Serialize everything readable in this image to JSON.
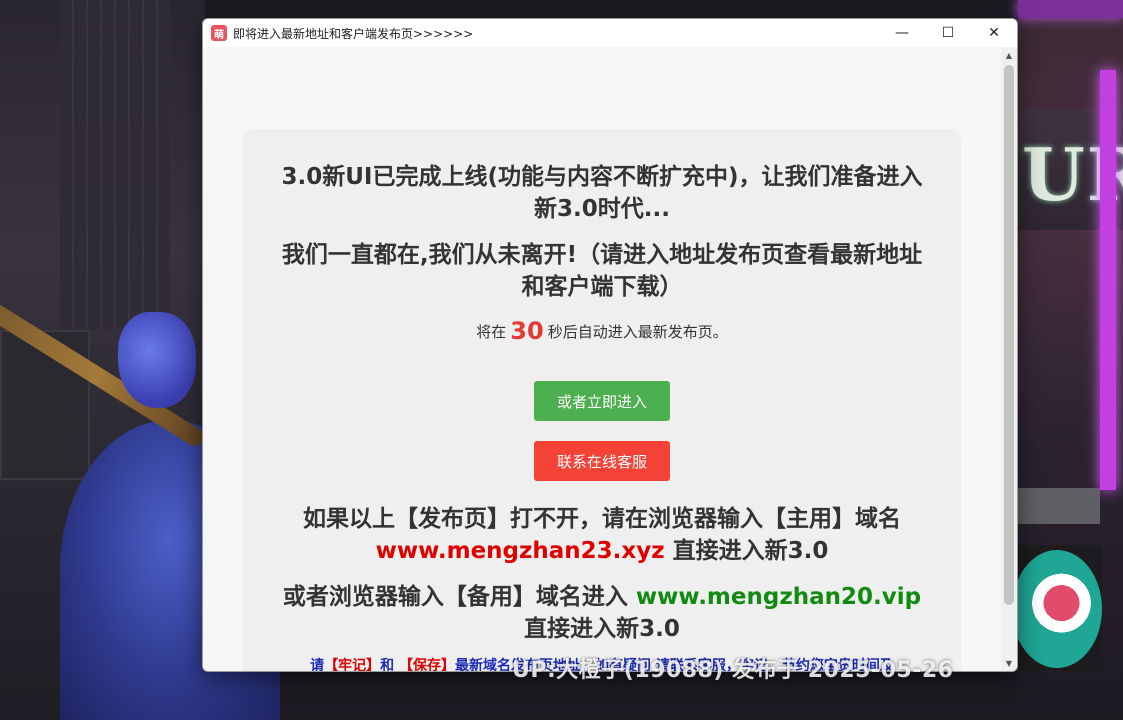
{
  "window": {
    "title": "即将进入最新地址和客户端发布页>>>>>>",
    "app_icon_glyph": "萌",
    "minimize_glyph": "—",
    "maximize_glyph": "☐",
    "close_glyph": "✕"
  },
  "content": {
    "headline1": "3.0新UI已完成上线(功能与内容不断扩充中)，让我们准备进入新3.0时代...",
    "headline2": "我们一直都在,我们从未离开!（请进入地址发布页查看最新地址和客户端下载）",
    "countdown": {
      "prefix": "将在",
      "seconds": "30",
      "suffix": "秒后自动进入最新发布页。"
    },
    "enter_button": "或者立即进入",
    "support_button": "联系在线客服",
    "primary": {
      "text_before": "如果以上【发布页】打不开，请在浏览器输入【主用】域名",
      "url": "www.mengzhan23.xyz",
      "text_after": " 直接进入新3.0"
    },
    "backup": {
      "text_before": "或者浏览器输入【备用】域名进入 ",
      "url": "www.mengzhan20.vip",
      "text_after": "直接进入新3.0"
    },
    "note": {
      "p1": "请",
      "m1": "【牢记】",
      "p2": "和",
      "m2": "【保存】",
      "p3": "最新域名发布页地址，如有疑问 请联系客服，牢记、节约您宝贵时间及"
    }
  },
  "overlay": {
    "watermark": "UP:大橙子(19088) 发布于 2025-05-26"
  },
  "background": {
    "sign_text": "UR"
  },
  "colors": {
    "green_button": "#4caf50",
    "red_button": "#f44336",
    "countdown_number": "#e53935",
    "primary_url": "#e00000",
    "backup_url": "#118a11",
    "note_text": "#1c2bb8"
  }
}
